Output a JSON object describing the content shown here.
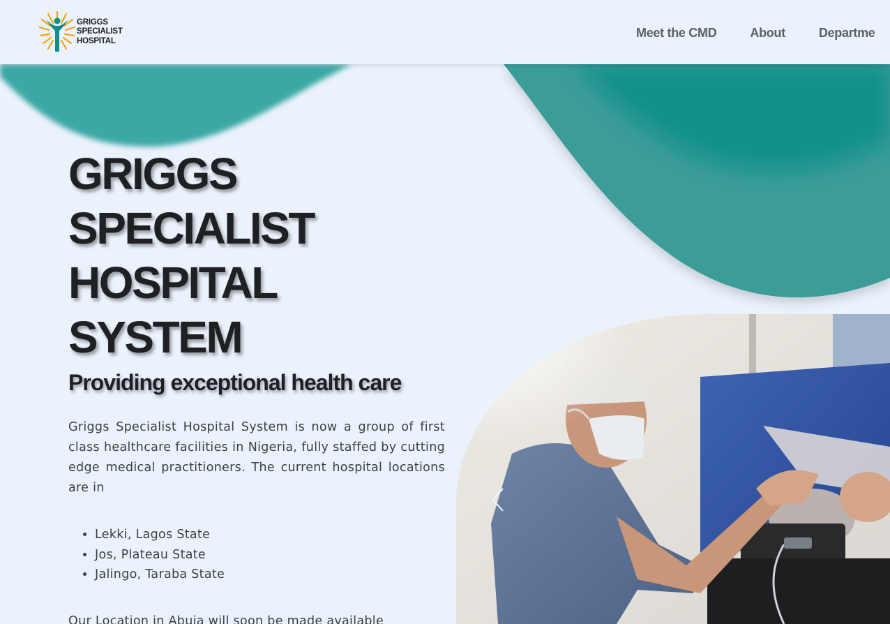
{
  "brand": {
    "logo_lines": [
      "GRIGGS",
      "SPECIALIST",
      "HOSPITAL"
    ],
    "colors": {
      "teal": "#0e8f8a",
      "teal_light": "#3aa8a4",
      "orange": "#f5a21b",
      "background": "#ebf2fc",
      "heading": "#1f2023"
    }
  },
  "nav": {
    "items": [
      {
        "label": "Meet the CMD"
      },
      {
        "label": "About"
      },
      {
        "label": "Departme"
      }
    ]
  },
  "hero": {
    "title_lines": [
      "GRIGGS",
      "SPECIALIST",
      "HOSPITAL",
      "SYSTEM"
    ],
    "subtitle": "Providing exceptional health care",
    "body": "Griggs Specialist Hospital System is now a group of first class healthcare facilities in Nigeria, fully staffed by cutting edge medical practitioners. The current hospital locations are in",
    "locations": [
      "Lekki, Lagos State",
      "Jos, Plateau State",
      "Jalingo, Taraba State"
    ],
    "note": "Our Location in Abuja will soon be made available"
  },
  "carousel": {
    "prev_icon": "chevron-left-icon"
  }
}
